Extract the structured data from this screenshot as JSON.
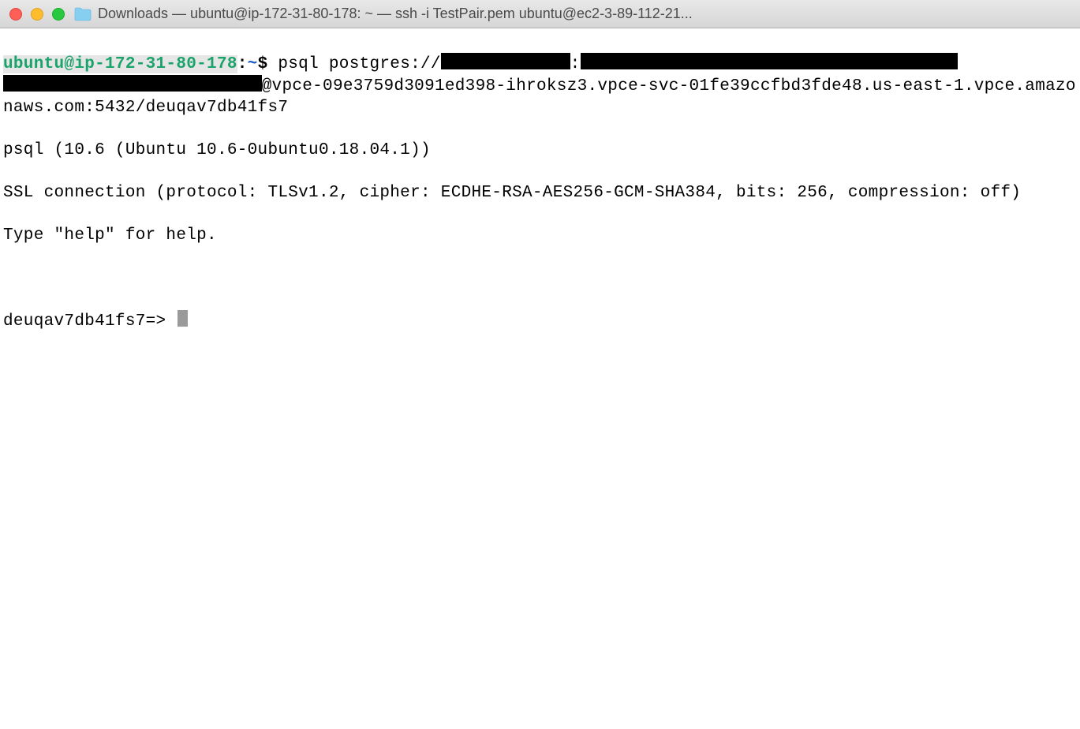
{
  "titlebar": {
    "title": "Downloads — ubuntu@ip-172-31-80-178: ~ — ssh -i TestPair.pem ubuntu@ec2-3-89-112-21..."
  },
  "prompt": {
    "user_host": "ubuntu@ip-172-31-80-178",
    "sep": ":",
    "path": "~",
    "symbol": "$"
  },
  "command": {
    "prefix": "psql postgres://",
    "colon_after_redact1": ":",
    "conn_part2": "@vpce-09e3759d3091ed398-ihroksz3.vpce-svc-01fe39ccfbd3fde48.us-east-1.vpce.amazonaws.com:5432/deuqav7db41fs7"
  },
  "output": {
    "version_line": "psql (10.6 (Ubuntu 10.6-0ubuntu0.18.04.1))",
    "ssl_line": "SSL connection (protocol: TLSv1.2, cipher: ECDHE-RSA-AES256-GCM-SHA384, bits: 256, compression: off)",
    "help_line": "Type \"help\" for help."
  },
  "psql_prompt": "deuqav7db41fs7=> "
}
